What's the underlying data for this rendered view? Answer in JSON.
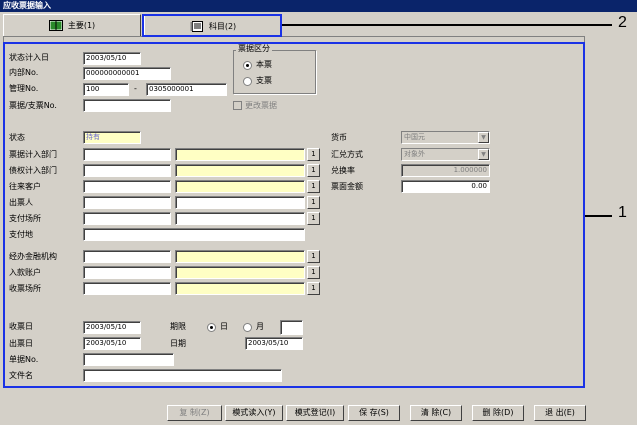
{
  "window": {
    "title": "应收票据输入"
  },
  "tabs": [
    {
      "label": "主要(1)",
      "icon": "book-icon"
    },
    {
      "label": "科目(2)",
      "icon": "notebook-icon"
    }
  ],
  "form": {
    "status_date_label": "状态计入日",
    "status_date_value": "2003/05/10",
    "internal_no_label": "内部No.",
    "internal_no_value": "000000000001",
    "management_no_label": "管理No.",
    "management_no_a": "100",
    "management_no_dash": "-",
    "management_no_b": "0305000001",
    "bill_no_label": "票据/支票No.",
    "bill_type_group": "票据区分",
    "bill_type_options": [
      "本票",
      "支票"
    ],
    "change_bill_label": "更改票据",
    "status_label": "状态",
    "status_value": "持有",
    "bill_dept_label": "票据计入部门",
    "credit_dept_label": "债权计入部门",
    "customer_label": "往来客户",
    "drawer_label": "出票人",
    "payment_place_label": "支付场所",
    "payment_location_label": "支付地",
    "financial_inst_label": "经办金融机构",
    "deposit_account_label": "入款账户",
    "collection_place_label": "收票场所",
    "receipt_date_label": "收票日",
    "receipt_date_value": "2003/05/10",
    "issue_date_label": "出票日",
    "issue_date_value": "2003/05/10",
    "term_label": "期限",
    "term_options": [
      "日",
      "月"
    ],
    "date_label": "日期",
    "date_value": "2003/05/10",
    "doc_no_label": "单据No.",
    "filename_label": "文件名",
    "currency_label": "货币",
    "currency_value": "中国元",
    "exchange_method_label": "汇兑方式",
    "exchange_method_value": "对象外",
    "exchange_rate_label": "兑换率",
    "exchange_rate_value": "1.000000",
    "face_amount_label": "票面金额",
    "face_amount_value": "0.00",
    "lookup_button": "1"
  },
  "buttons": [
    "复 制(Z)",
    "模式读入(Y)",
    "模式登记(I)",
    "保 存(S)",
    "清 除(C)",
    "删 除(D)",
    "退 出(E)"
  ],
  "callouts": [
    "1",
    "2"
  ],
  "colors": {
    "highlight": "#1a32e6",
    "title_bar": "#0a246a",
    "required_field": "#ffffc4"
  }
}
